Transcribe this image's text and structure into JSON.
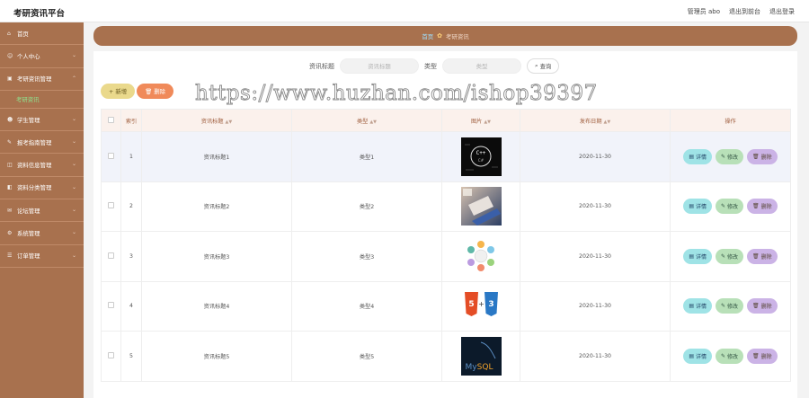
{
  "app": {
    "title": "考研资讯平台",
    "links": [
      "管理员 abo",
      "退出到前台",
      "退出登录"
    ]
  },
  "sidebar": {
    "items": [
      {
        "label": "首页",
        "icon": "home-icon"
      },
      {
        "label": "个人中心",
        "icon": "user-icon"
      },
      {
        "label": "考研资讯管理",
        "icon": "news-icon",
        "expanded": true,
        "sub": "考研资讯"
      },
      {
        "label": "学生管理",
        "icon": "student-icon"
      },
      {
        "label": "报考指南管理",
        "icon": "guide-icon"
      },
      {
        "label": "资料信息管理",
        "icon": "doc-icon"
      },
      {
        "label": "资料分类管理",
        "icon": "category-icon"
      },
      {
        "label": "论坛管理",
        "icon": "forum-icon"
      },
      {
        "label": "系统管理",
        "icon": "settings-icon"
      },
      {
        "label": "订单管理",
        "icon": "order-icon"
      }
    ]
  },
  "breadcrumb": {
    "home": "首页",
    "separator": "✿",
    "current": "考研资讯"
  },
  "search": {
    "title_label": "资讯标题",
    "title_placeholder": "资讯标题",
    "type_label": "类型",
    "type_placeholder": "类型",
    "query_button": "查询"
  },
  "toolbar": {
    "add_label": "新增",
    "delete_label": "删除"
  },
  "watermark": "https://www.huzhan.com/ishop39397",
  "table": {
    "headers": {
      "index": "索引",
      "title": "资讯标题",
      "type": "类型",
      "image": "图片",
      "date": "发布日期",
      "actions": "操作"
    },
    "action_labels": {
      "detail": "详情",
      "edit": "修改",
      "delete": "删除"
    },
    "rows": [
      {
        "index": "1",
        "title": "资讯标题1",
        "type": "类型1",
        "image": "cpp-image",
        "date": "2020-11-30"
      },
      {
        "index": "2",
        "title": "资讯标题2",
        "type": "类型2",
        "image": "laptop-image",
        "date": "2020-11-30"
      },
      {
        "index": "3",
        "title": "资讯标题3",
        "type": "类型3",
        "image": "diagram-image",
        "date": "2020-11-30"
      },
      {
        "index": "4",
        "title": "资讯标题4",
        "type": "类型4",
        "image": "html-css-image",
        "date": "2020-11-30"
      },
      {
        "index": "5",
        "title": "资讯标题5",
        "type": "类型5",
        "image": "mysql-image",
        "date": "2020-11-30"
      }
    ]
  },
  "colors": {
    "brand": "#a8714e",
    "detail": "#9fe3e6",
    "edit": "#b8e0b8",
    "delete": "#cbb3e6"
  }
}
